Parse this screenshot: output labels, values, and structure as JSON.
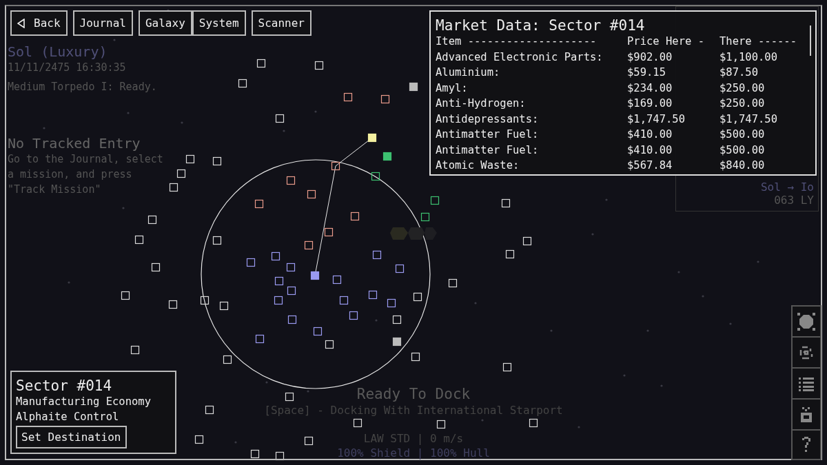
{
  "nav": [
    {
      "label": "Back",
      "kind": "back"
    },
    {
      "label": "Journal",
      "kind": "plain"
    },
    {
      "label": "Galaxy",
      "kind": "plain"
    },
    {
      "label": "System",
      "kind": "plain"
    },
    {
      "label": "Scanner",
      "kind": "plain"
    }
  ],
  "location": {
    "title": "Sol (Luxury)",
    "datetime": "11/11/2475 16:30:35",
    "status": "Medium Torpedo I: Ready."
  },
  "tracking": {
    "title": "No Tracked Entry",
    "hint": "Go to the Journal, select a mission, and press \"Track Mission\""
  },
  "market": {
    "title": "Market Data: Sector #014",
    "columns": [
      "Item --------------------",
      "Price Here -",
      "There ------"
    ],
    "rows": [
      [
        "Advanced Electronic Parts:",
        "$902.00",
        "$1,100.00"
      ],
      [
        "Aluminium:",
        "$59.15",
        "$87.50"
      ],
      [
        "Amyl:",
        "$234.00",
        "$250.00"
      ],
      [
        "Anti-Hydrogen:",
        "$169.00",
        "$250.00"
      ],
      [
        "Antidepressants:",
        "$1,747.50",
        "$1,747.50"
      ],
      [
        "Antimatter Fuel:",
        "$410.00",
        "$500.00"
      ],
      [
        "Antimatter Fuel:",
        "$410.00",
        "$500.00"
      ],
      [
        "Atomic Waste:",
        "$567.84",
        "$840.00"
      ]
    ]
  },
  "route": {
    "path": "Sol → Io",
    "distance": "063 LY"
  },
  "sector": {
    "title": "Sector #014",
    "economy": "Manufacturing Economy",
    "faction": "Alphaite Control",
    "button": "Set Destination"
  },
  "dock": {
    "title": "Ready To Dock",
    "action": "[Space] - Docking With International Starport"
  },
  "ship": {
    "status": "LAW STD | 0 m/s",
    "integrity": "100% Shield | 100% Hull"
  }
}
